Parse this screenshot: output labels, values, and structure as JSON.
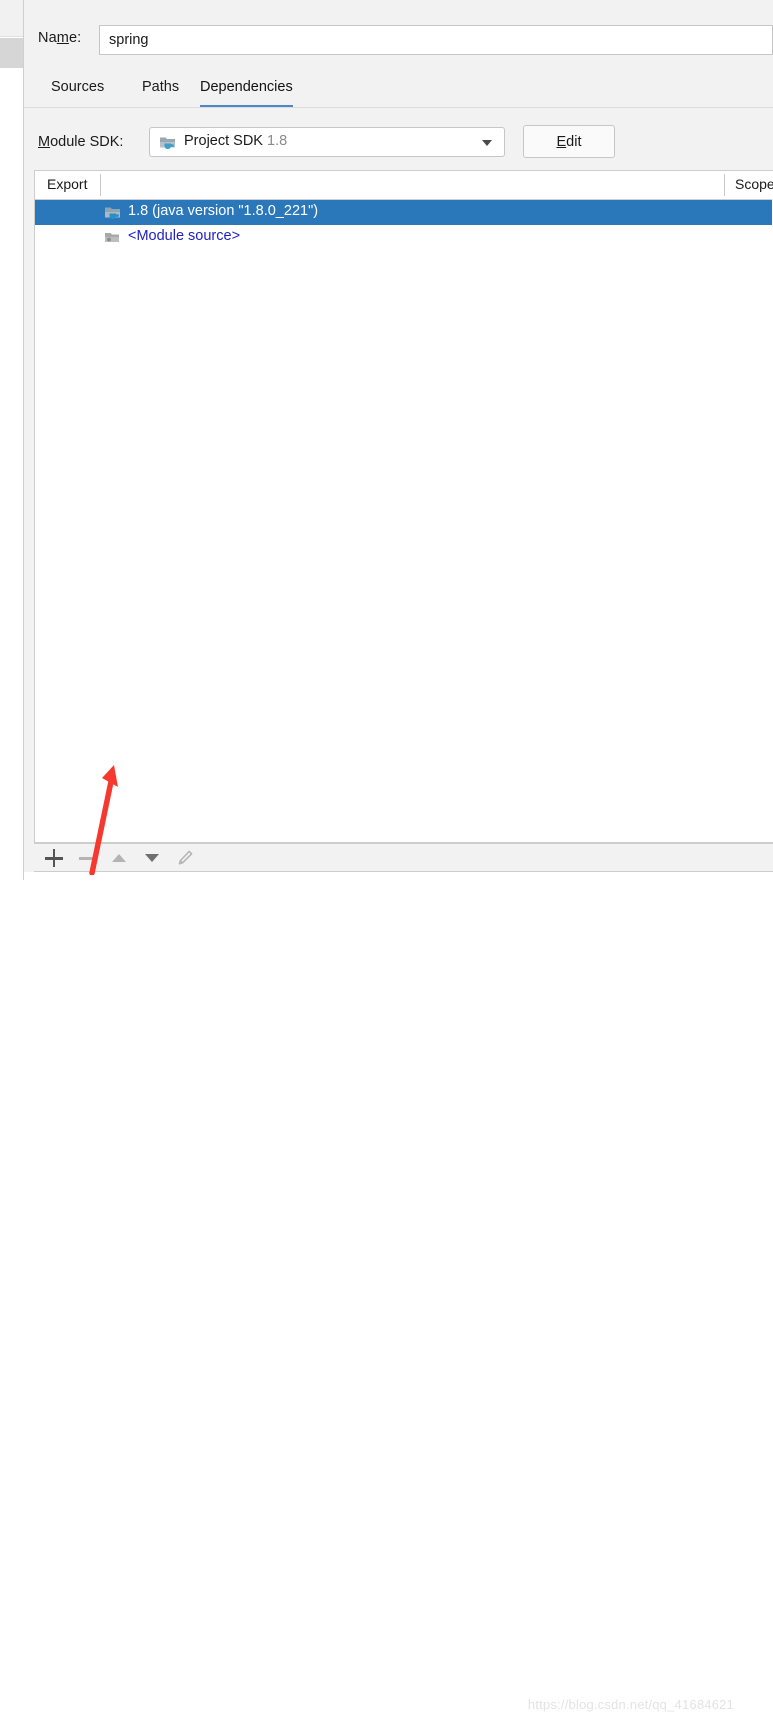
{
  "name_row": {
    "label_prefix": "Na",
    "label_mnemonic": "m",
    "label_suffix": "e:",
    "label_full": "Name:",
    "value": "spring",
    "placeholder": ""
  },
  "tabs": [
    {
      "label": "Sources",
      "active": false
    },
    {
      "label": "Paths",
      "active": false
    },
    {
      "label": "Dependencies",
      "active": true
    }
  ],
  "sdk_row": {
    "label_prefix": "",
    "label_mnemonic": "M",
    "label_suffix": "odule SDK:",
    "label_full": "Module SDK:",
    "combo_icon": "sdk-folder-java-icon",
    "combo_text": "Project SDK",
    "combo_version": "1.8",
    "edit_button_mnemonic": "E",
    "edit_button_rest": "dit",
    "edit_button_label": "Edit"
  },
  "table": {
    "columns": [
      {
        "key": "export",
        "label": "Export"
      },
      {
        "key": "scope",
        "label": "Scope"
      }
    ],
    "rows": [
      {
        "icon": "sdk-folder-java-icon",
        "label": "1.8 (java version \"1.8.0_221\")",
        "selected": true,
        "export_checked": false,
        "scope": ""
      },
      {
        "icon": "module-source-folder-icon",
        "label": "<Module source>",
        "selected": false,
        "export_checked": false,
        "scope": ""
      }
    ]
  },
  "toolbar": {
    "buttons": [
      {
        "name": "add",
        "icon": "plus-icon",
        "enabled": true
      },
      {
        "name": "remove",
        "icon": "minus-icon",
        "enabled": false
      },
      {
        "name": "move-up",
        "icon": "triangle-up-icon",
        "enabled": false
      },
      {
        "name": "move-down",
        "icon": "triangle-down-icon",
        "enabled": true
      },
      {
        "name": "edit",
        "icon": "pencil-icon",
        "enabled": false
      }
    ]
  },
  "annotation": {
    "type": "red-arrow",
    "color": "#f5392f",
    "points_to": "add-dependency-button"
  },
  "watermark": {
    "text": "https://blog.csdn.net/qq_41684621"
  },
  "colors": {
    "selection_blue": "#2a77ba",
    "tab_underline": "#4a88c7",
    "link_blue": "#2121c0",
    "dialog_bg": "#f2f2f2",
    "annotation_red": "#f5392f"
  }
}
